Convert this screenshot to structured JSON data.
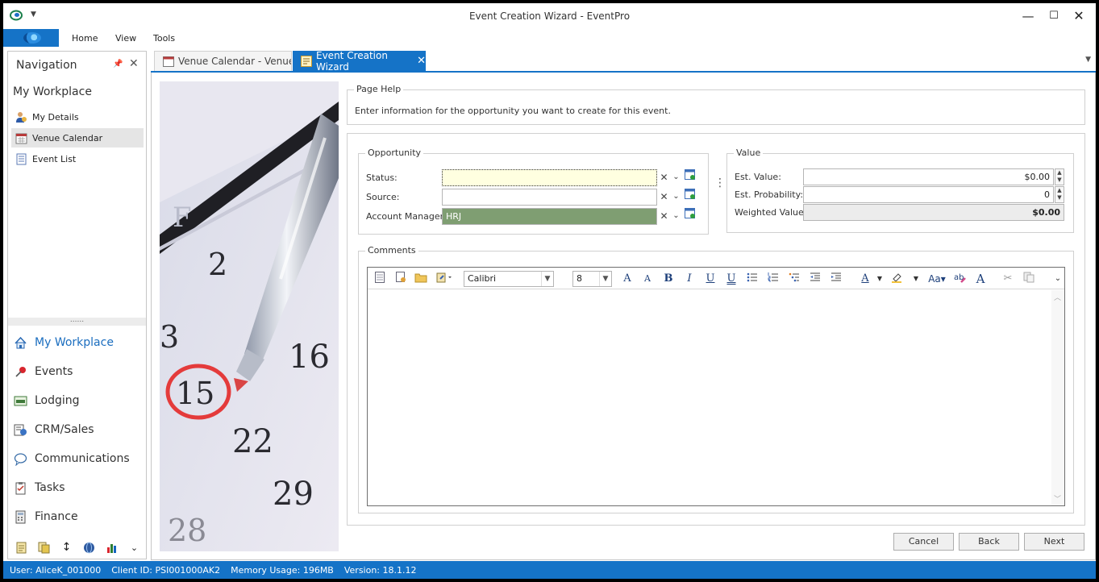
{
  "window": {
    "title": "Event Creation Wizard - EventPro"
  },
  "ribbon": {
    "tabs": [
      "Home",
      "View",
      "Tools"
    ]
  },
  "navigation": {
    "header": "Navigation",
    "section_title": "My Workplace",
    "items": [
      {
        "label": "My Details",
        "icon": "user-icon"
      },
      {
        "label": "Venue Calendar",
        "icon": "calendar-icon",
        "selected": true
      },
      {
        "label": "Event List",
        "icon": "list-icon"
      }
    ],
    "modules": [
      {
        "label": "My Workplace",
        "icon": "house-icon",
        "active": true
      },
      {
        "label": "Events",
        "icon": "pushpin-icon"
      },
      {
        "label": "Lodging",
        "icon": "bed-icon"
      },
      {
        "label": "CRM/Sales",
        "icon": "crm-icon"
      },
      {
        "label": "Communications",
        "icon": "speech-bubble-icon"
      },
      {
        "label": "Tasks",
        "icon": "clipboard-icon"
      },
      {
        "label": "Finance",
        "icon": "calculator-icon"
      }
    ]
  },
  "doc_tabs": [
    {
      "label": "Venue Calendar - Venue"
    },
    {
      "label": "Event Creation Wizard",
      "active": true,
      "close": "✕"
    }
  ],
  "page_help": {
    "legend": "Page Help",
    "text": "Enter information for the opportunity you want to create for this event."
  },
  "opportunity": {
    "legend": "Opportunity",
    "status_label": "Status:",
    "status_value": "",
    "source_label": "Source:",
    "source_value": "",
    "account_manager_label": "Account Manager:",
    "account_manager_value": "HRJ"
  },
  "value": {
    "legend": "Value",
    "est_value_label": "Est. Value:",
    "est_value": "$0.00",
    "est_probability_label": "Est. Probability:",
    "est_probability": "0",
    "weighted_value_label": "Weighted Value:",
    "weighted_value": "$0.00"
  },
  "comments": {
    "legend": "Comments",
    "font_name": "Calibri",
    "font_size": "8",
    "text": ""
  },
  "buttons": {
    "cancel": "Cancel",
    "back": "Back",
    "next": "Next"
  },
  "status_bar": {
    "user": "User: AliceK_001000",
    "client_id": "Client ID: PSI001000AK2",
    "memory": "Memory Usage: 196MB",
    "version": "Version: 18.1.12"
  },
  "colors": {
    "accent": "#1573c7",
    "required_field": "#ffffe0",
    "account_manager_field": "#7f9e72"
  }
}
